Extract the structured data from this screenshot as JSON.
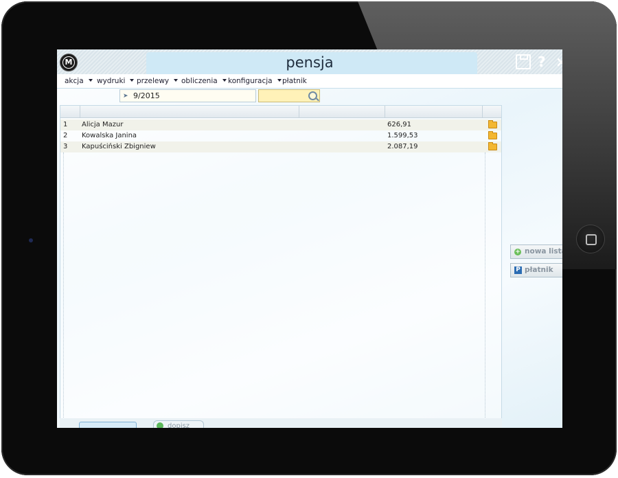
{
  "app": {
    "title": "pensja",
    "logo_text": "M"
  },
  "toolbar": {
    "help_glyph": "?",
    "close_glyph": "×"
  },
  "menu": [
    {
      "label": "akcja",
      "has_caret": true
    },
    {
      "label": "wydruki",
      "has_caret": true
    },
    {
      "label": "przelewy",
      "has_caret": true
    },
    {
      "label": "obliczenia",
      "has_caret": true
    },
    {
      "label": "konfiguracja",
      "has_caret": true
    },
    {
      "label": "płatnik",
      "has_caret": false
    }
  ],
  "filter": {
    "period": "9/2015",
    "search_value": ""
  },
  "table": {
    "columns": [
      "",
      "",
      "",
      "",
      ""
    ],
    "rows": [
      {
        "no": "1",
        "name": "Alicja Mazur",
        "amount": "626,91"
      },
      {
        "no": "2",
        "name": "Kowalska Janina",
        "amount": "1.599,53"
      },
      {
        "no": "3",
        "name": "Kapuściński Zbigniew",
        "amount": "2.087,19"
      }
    ]
  },
  "side_panel": {
    "new_list_label": "nowa lista",
    "payer_label": "płatnik",
    "payer_icon_letter": "P",
    "plus_glyph": "+"
  },
  "bottom": {
    "add_button_label": "dopisz"
  },
  "colors": {
    "accent": "#cfe9f6",
    "search_bg": "#fff2b8",
    "folder": "#f3b731"
  }
}
